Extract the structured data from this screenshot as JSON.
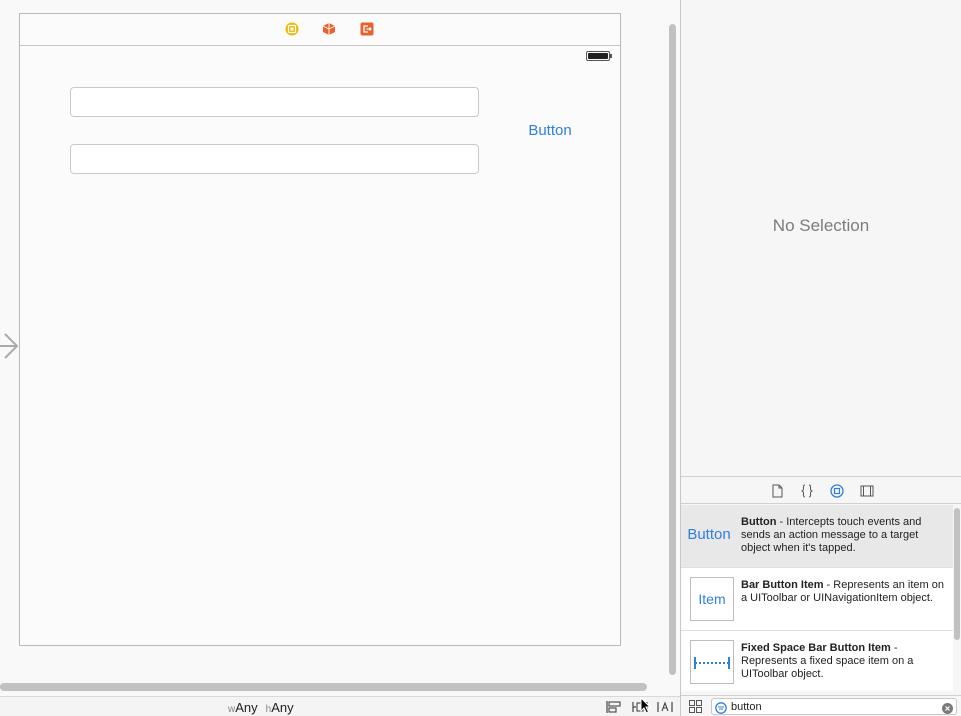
{
  "canvas": {
    "button_title": "Button",
    "text_fields": [
      {
        "value": ""
      },
      {
        "value": ""
      }
    ],
    "size_class": {
      "w_prefix": "w",
      "w_value": "Any",
      "h_prefix": "h",
      "h_value": "Any"
    }
  },
  "icons": {
    "dock": [
      "view-controller-icon",
      "first-responder-icon",
      "exit-icon"
    ],
    "canvas_tools": [
      "align-icon",
      "pin-icon",
      "resolve-issues-icon"
    ],
    "library_tabs": [
      "file-template-icon",
      "code-snippet-icon",
      "object-library-icon",
      "media-library-icon"
    ]
  },
  "inspector": {
    "empty_message": "No Selection"
  },
  "library": {
    "items": [
      {
        "thumb": "Button",
        "title": "Button",
        "description": " - Intercepts touch events and sends an action message to a target object when it's tapped."
      },
      {
        "thumb": "Item",
        "title": "Bar Button Item",
        "description": " - Represents an item on a UIToolbar or UINavigationItem object."
      },
      {
        "thumb": "",
        "title": "Fixed Space Bar Button Item",
        "description": " - Represents a fixed space item on a UIToolbar object."
      }
    ],
    "filter": {
      "value": "button",
      "placeholder": ""
    }
  },
  "colors": {
    "accent": "#2f7fdc",
    "dock_vc": "#f2b705",
    "dock_fr": "#e8622c",
    "dock_exit": "#e8622c"
  }
}
